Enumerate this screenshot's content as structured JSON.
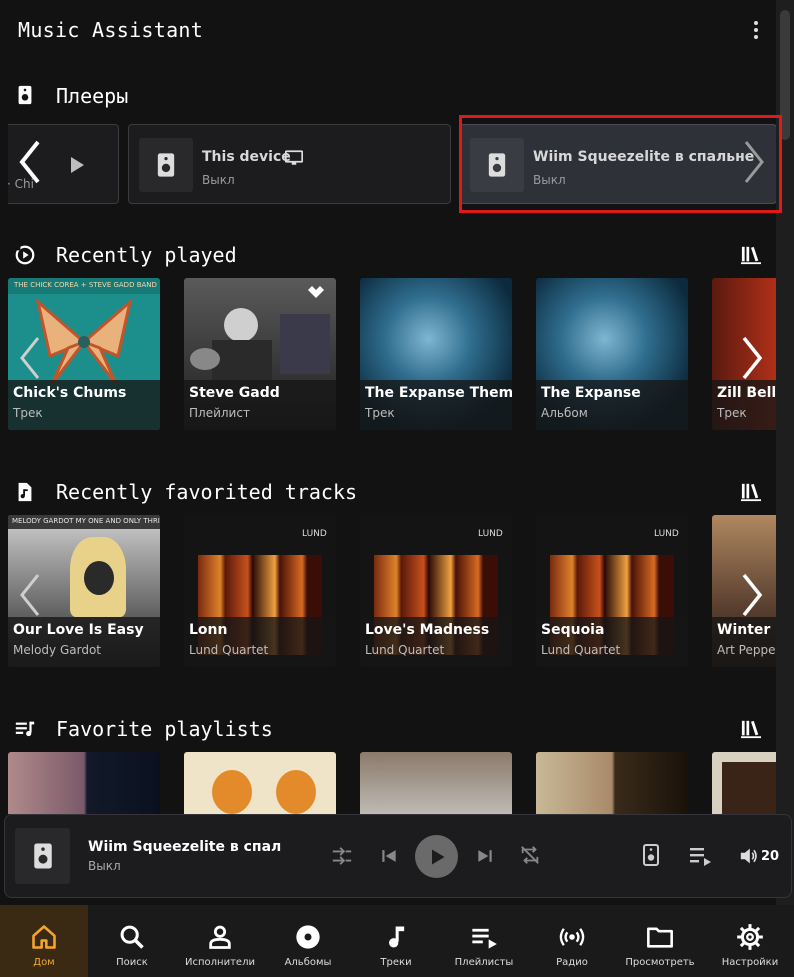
{
  "app": {
    "title": "Music Assistant"
  },
  "sections": {
    "players": "Плееры",
    "recently_played": "Recently played",
    "recently_favorited": "Recently favorited tracks",
    "favorite_playlists": "Favorite playlists"
  },
  "players": [
    {
      "name": "",
      "state": "· Chi"
    },
    {
      "name": "This device",
      "state": "Выкл"
    },
    {
      "name": "Wiim Squeezelite в спальне",
      "state": "Выкл"
    }
  ],
  "recently_played": [
    {
      "title": "Chick's Chums",
      "subtitle": "Трек",
      "cover_text": "THE CHICK COREA + STEVE GADD BAND"
    },
    {
      "title": "Steve Gadd",
      "subtitle": "Плейлист"
    },
    {
      "title": "The Expanse Theme",
      "subtitle": "Трек"
    },
    {
      "title": "The Expanse",
      "subtitle": "Альбом"
    },
    {
      "title": "Zill Bell",
      "subtitle": "Трек"
    }
  ],
  "recently_favorited": [
    {
      "title": "Our Love Is Easy",
      "subtitle": "Melody Gardot",
      "cover_text": "MELODY GARDOT MY ONE AND ONLY THRILL"
    },
    {
      "title": "Lonn",
      "subtitle": "Lund Quartet",
      "cover_text": "LUND"
    },
    {
      "title": "Love's Madness",
      "subtitle": "Lund Quartet",
      "cover_text": "LUND"
    },
    {
      "title": "Sequoia",
      "subtitle": "Lund Quartet",
      "cover_text": "LUND"
    },
    {
      "title": "Winter Mo",
      "subtitle": "Art Pepper"
    }
  ],
  "now_playing": {
    "title": "Wiim Squeezelite в спал",
    "subtitle": "Выкл",
    "volume": "20"
  },
  "nav": [
    {
      "label": "Дом",
      "icon": "home-icon"
    },
    {
      "label": "Поиск",
      "icon": "search-icon"
    },
    {
      "label": "Исполнители",
      "icon": "person-icon"
    },
    {
      "label": "Альбомы",
      "icon": "disc-icon"
    },
    {
      "label": "Треки",
      "icon": "music-note-icon"
    },
    {
      "label": "Плейлисты",
      "icon": "playlist-icon"
    },
    {
      "label": "Радио",
      "icon": "radio-icon"
    },
    {
      "label": "Просмотреть",
      "icon": "folder-icon"
    },
    {
      "label": "Настройки",
      "icon": "gear-icon"
    }
  ],
  "colors": {
    "accent": "#f4a62a",
    "background": "#121212",
    "highlight": "#e01a1a"
  }
}
